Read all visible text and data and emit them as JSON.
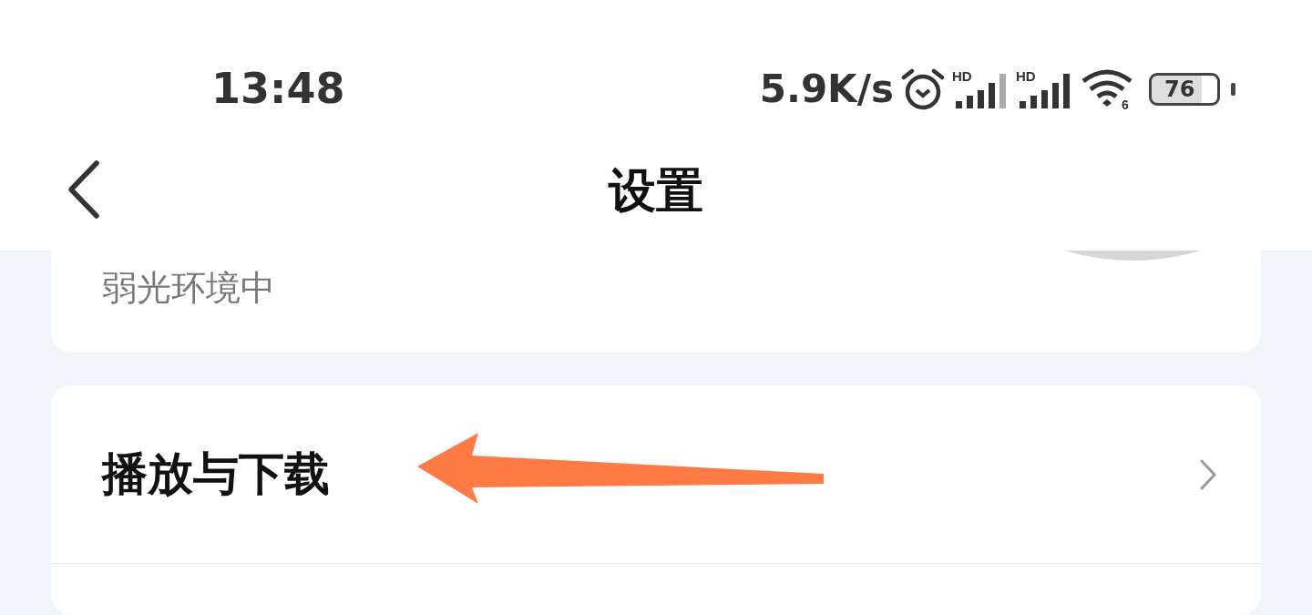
{
  "status_bar": {
    "time": "13:48",
    "net_speed": "5.9K/s",
    "signal_labels": [
      "HD",
      "HD"
    ],
    "wifi_label": "6",
    "battery": "76"
  },
  "header": {
    "title": "设置"
  },
  "cards": [
    {
      "kind": "tail",
      "description": "弱光环境中"
    },
    {
      "kind": "link",
      "label": "播放与下载"
    }
  ]
}
